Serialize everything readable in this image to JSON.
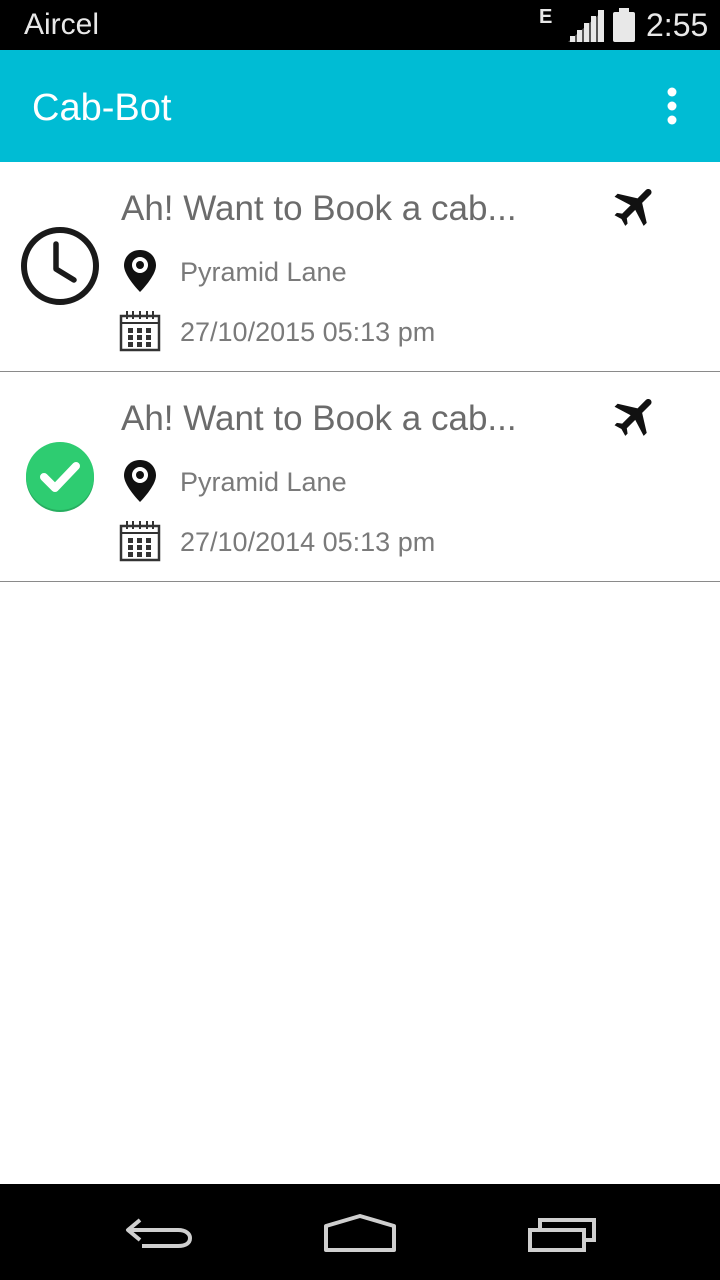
{
  "status_bar": {
    "carrier": "Aircel",
    "network_type": "E",
    "time": "2:55"
  },
  "app_bar": {
    "title": "Cab-Bot",
    "menu_icon": "more-vert-icon"
  },
  "bookings": [
    {
      "status": "scheduled",
      "status_icon": "clock-icon",
      "title": "Ah! Want to Book a cab...",
      "type_icon": "airplane-icon",
      "location": "Pyramid Lane",
      "datetime": "27/10/2015 05:13 pm"
    },
    {
      "status": "completed",
      "status_icon": "check-circle-icon",
      "title": "Ah! Want to Book a cab...",
      "type_icon": "airplane-icon",
      "location": "Pyramid Lane",
      "datetime": "27/10/2014 05:13 pm"
    }
  ],
  "nav_bar": {
    "icons": [
      "back-icon",
      "home-icon",
      "recent-apps-icon"
    ]
  },
  "colors": {
    "primary": "#00bcd4",
    "success": "#2ecc71",
    "text_secondary": "#7a7a7a"
  }
}
